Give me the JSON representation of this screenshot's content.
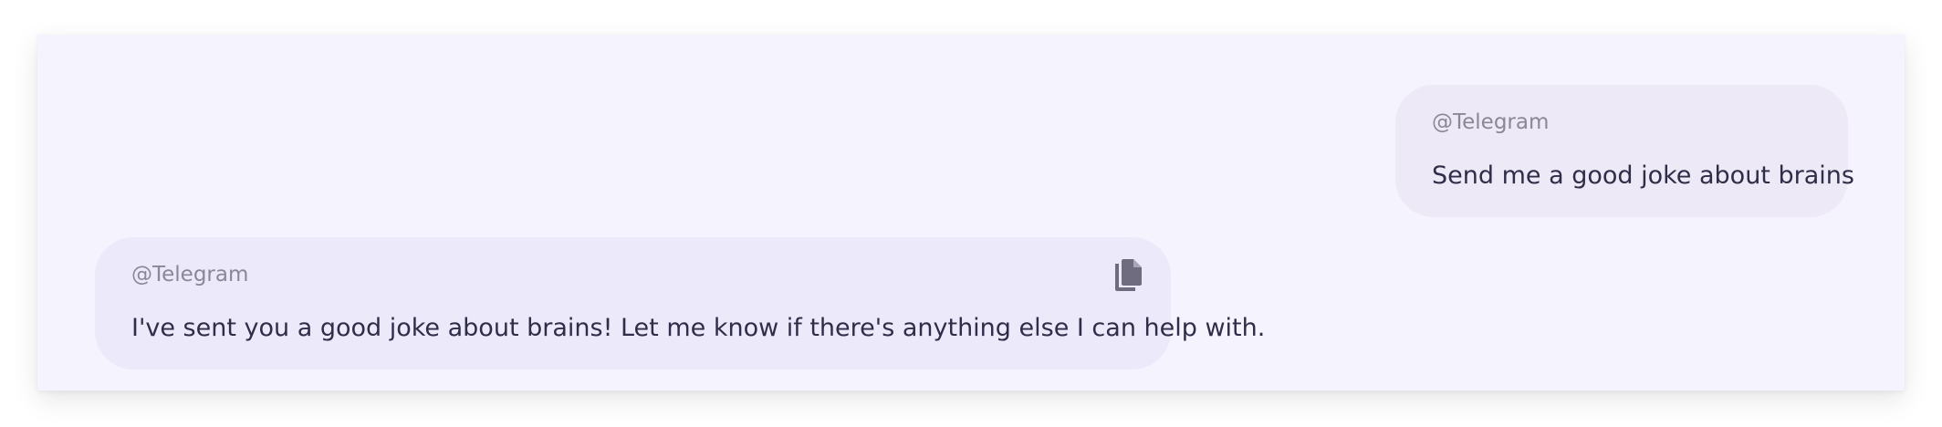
{
  "conversation": {
    "messages": [
      {
        "role": "user",
        "source": "@Telegram",
        "text": "Send me a good joke about brains"
      },
      {
        "role": "assistant",
        "source": "@Telegram",
        "text": "I've sent you a good joke about brains! Let me know if there's anything else I can help with.",
        "copy_icon": "copy-icon"
      }
    ]
  },
  "colors": {
    "panel_background": "#f5f3fd",
    "user_bubble": "#ede9f6",
    "assistant_bubble": "#ece9fb",
    "source_text": "#8a8796",
    "message_text": "#2f2d48",
    "icon": "#6f6c7f"
  }
}
